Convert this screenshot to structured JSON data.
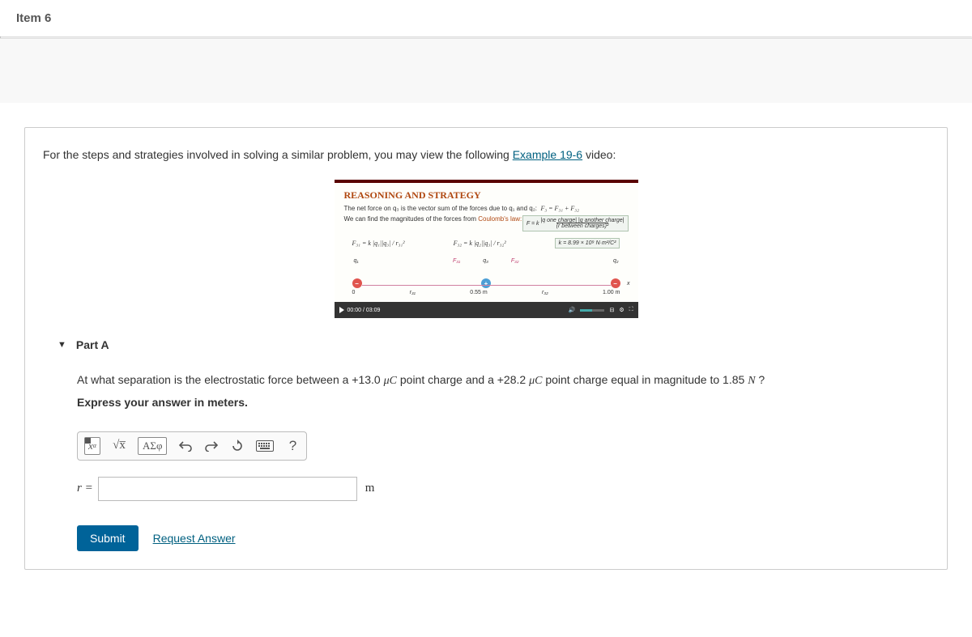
{
  "header": {
    "title": "Item 6"
  },
  "intro": {
    "text_before": "For the steps and strategies involved in solving a similar problem, you may view the following ",
    "link": "Example 19-6",
    "text_after": " video:"
  },
  "video": {
    "title": "REASONING AND STRATEGY",
    "line1_a": "The net force on q₃ is the vector sum of the forces due to q₁ and q₂:",
    "line1_b": "F₃ = F₃₁ + F₃₂",
    "line2_a": "We can find the magnitudes of the forces from ",
    "line2_b": "Coulomb's law:",
    "box_top": "|q one charge| |q another charge|",
    "box_bottom": "(r between charges)²",
    "formula_left": "F₃₁ = k |q₁||q₃| / r₃₁²",
    "formula_right": "F₃₂ = k |q₂||q₃| / r₃₂²",
    "k_value": "k = 8.99 × 10⁹ N·m²/C²",
    "q_labels": {
      "q1": "q₁",
      "q3": "q₃",
      "q2": "q₂"
    },
    "diagram": {
      "origin": "0",
      "r31": "r₃₁",
      "mid_dist": "0.55 m",
      "r32": "r₃₂",
      "right_dist": "1.00 m",
      "x_axis": "x",
      "f31": "F₃₁",
      "f32": "F₃₂"
    },
    "time": "00:00 / 03:09"
  },
  "part": {
    "label": "Part A",
    "question_a": "At what separation is the electrostatic force between a +13.0 ",
    "unit1": "μC",
    "question_b": " point charge and a +28.2 ",
    "unit2": "μC",
    "question_c": " point charge equal in magnitude to 1.85 ",
    "force_unit": "N",
    "question_d": " ?",
    "instruction": "Express your answer in meters.",
    "greek_button": "ΑΣφ",
    "help_label": "?",
    "answer_label": "r =",
    "answer_unit": "m",
    "submit": "Submit",
    "request": "Request Answer"
  }
}
